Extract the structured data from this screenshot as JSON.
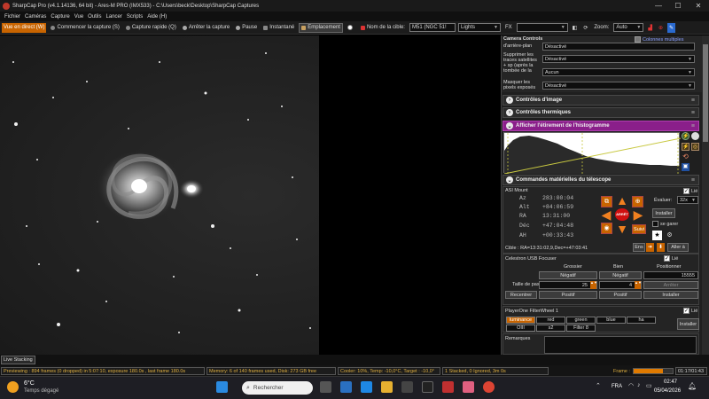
{
  "window": {
    "title": "SharpCap Pro (v4.1.14136, 64 bit) - Ares-M PRO (IMX533) - C:\\Users\\beck\\Desktop\\SharpCap Captures",
    "minimize": "—",
    "maximize": "☐",
    "close": "✕"
  },
  "menu": [
    "Fichier",
    "Caméras",
    "Capture",
    "Vue",
    "Outils",
    "Lancer",
    "Scripts",
    "Aide (H)"
  ],
  "toolbar": {
    "live_view": "Vue en direct (W)",
    "start_capture": "Commencer la capture (S)",
    "quick_capture": "Capture rapide (Q)",
    "stop_capture": "Arrêter la capture",
    "pause": "Pause",
    "snapshot": "Instantané",
    "placement": "Emplacement",
    "target_label": "Nom de la cible:",
    "target_value": "M51 (NGC 51!",
    "frame_type": "Lights",
    "fx_label": "FX",
    "fx_value": "",
    "zoom_label": "Zoom:",
    "zoom_value": "Auto"
  },
  "camera_controls": {
    "title": "Camera Controls",
    "multi_columns": "Colonnes multiples",
    "rows": [
      {
        "label": "d'arrière-plan",
        "value": "Désactivé"
      },
      {
        "label": "Supprimer les traces satellites + sp (après la tombée de la nuit) rdes)",
        "value": "Désactivé"
      },
      {
        "label": "",
        "value": "Aucun"
      },
      {
        "label": "Masquer les pixels exposés",
        "value": "Désactivé"
      }
    ]
  },
  "sections": {
    "image_controls": "Contrôles d'image",
    "thermal_controls": "Contrôles thermiques",
    "histogram": "Afficher l'étirement de l'histogramme",
    "telescope": "Commandes matérielles du télescope"
  },
  "mount": {
    "name": "ASI Mount",
    "linked": "Lié",
    "az_label": "Az",
    "az_value": "283:00:04",
    "alt_label": "Alt",
    "alt_value": "+84:06:59",
    "ra_label": "RA",
    "ra_value": "13:31:00",
    "dec_label": "Déc",
    "dec_value": "+47:04:48",
    "ah_label": "AH",
    "ah_value": "+00:33:43",
    "evaluate_label": "Évaluer:",
    "rate": "32x",
    "install": "Installer",
    "park": "se garer",
    "stop": "ARRÊT",
    "follow": "Suivi",
    "target": "Cible : RA=13:31:02,9,Dec=+47:03:41",
    "slew_btn": "Ens",
    "goto_btn": "Aller à"
  },
  "focuser": {
    "name": "Celestron USB Focuser",
    "linked": "Lié",
    "coarse": "Grossier",
    "fine": "Bien",
    "position": "Positionner",
    "negative": "Négatif",
    "negative2": "Négatif",
    "position_value": "15555",
    "step_label": "Taille de pas",
    "coarse_step": "25",
    "fine_step": "4",
    "stop": "Arrêter",
    "positive": "Positif",
    "positive2": "Positif",
    "recenter": "Recentrer",
    "install": "Installer"
  },
  "filterwheel": {
    "name": "PlayerOne FilterWheel 1",
    "linked": "Lié",
    "filters": [
      "luminance",
      "red",
      "green",
      "blue",
      "ha",
      "OIII",
      "s2",
      "Filter 8"
    ],
    "install": "Installer"
  },
  "remarks": "Remarques",
  "bottom": {
    "live_stacking": "Live Stacking",
    "status": "Previewing : 894 frames (0 dropped) in 5:07:10, exposure 180.0s , last frame 180.0s",
    "memory": "Memory: 6 of 140 frames used, Disk: 273 GB free",
    "cooler": "Cooler: 10%, Temp: -10,0°C, Target : -10,0°",
    "stacked": "1 Stacked, 0 Ignored, 3m 0s",
    "frame_label": "Frame :",
    "frame_time": "01:17/01:43",
    "frame_progress": 0.74
  },
  "taskbar": {
    "weather_temp": "6°C",
    "weather_desc": "Temps dégagé",
    "search": "Rechercher",
    "lang": "FRA",
    "time": "02:47",
    "date": "05/04/2026"
  }
}
